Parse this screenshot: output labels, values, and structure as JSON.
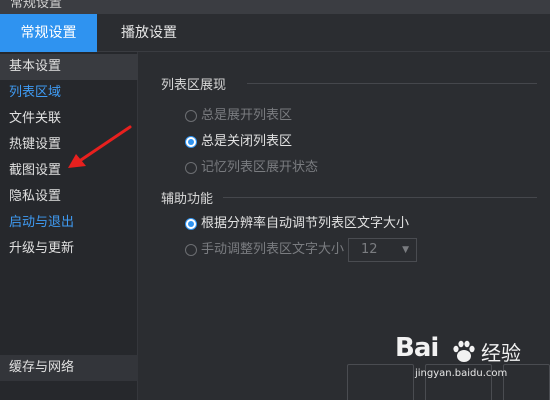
{
  "window": {
    "title": "常规设置"
  },
  "tabs": [
    {
      "label": "常规设置",
      "active": true
    },
    {
      "label": "播放设置",
      "active": false
    }
  ],
  "sidebar": {
    "items": [
      {
        "label": "基本设置",
        "state": "selected"
      },
      {
        "label": "列表区域",
        "state": "highlighted"
      },
      {
        "label": "文件关联",
        "state": "normal"
      },
      {
        "label": "热键设置",
        "state": "normal"
      },
      {
        "label": "截图设置",
        "state": "normal"
      },
      {
        "label": "隐私设置",
        "state": "normal"
      },
      {
        "label": "启动与退出",
        "state": "highlighted"
      },
      {
        "label": "升级与更新",
        "state": "normal"
      }
    ],
    "bottom_item": {
      "label": "缓存与网络"
    }
  },
  "list_display": {
    "heading": "列表区展现",
    "options": [
      {
        "label": "总是展开列表区",
        "checked": false,
        "disabled": true
      },
      {
        "label": "总是关闭列表区",
        "checked": true,
        "disabled": false
      },
      {
        "label": "记忆列表区展开状态",
        "checked": false,
        "disabled": true
      }
    ]
  },
  "assist": {
    "heading": "辅助功能",
    "options": [
      {
        "label": "根据分辨率自动调节列表区文字大小",
        "checked": true,
        "disabled": false
      },
      {
        "label": "手动调整列表区文字大小",
        "checked": false,
        "disabled": true
      }
    ],
    "font_size_select": {
      "value": "12",
      "disabled": true
    }
  },
  "watermark": {
    "logo": "Bai",
    "brand_cn": "经验",
    "url": "jingyan.baidu.com"
  },
  "colors": {
    "accent": "#2f93f0",
    "background": "#2b2d31",
    "sidebar": "#26282c",
    "annotation_arrow": "#e8201e"
  }
}
